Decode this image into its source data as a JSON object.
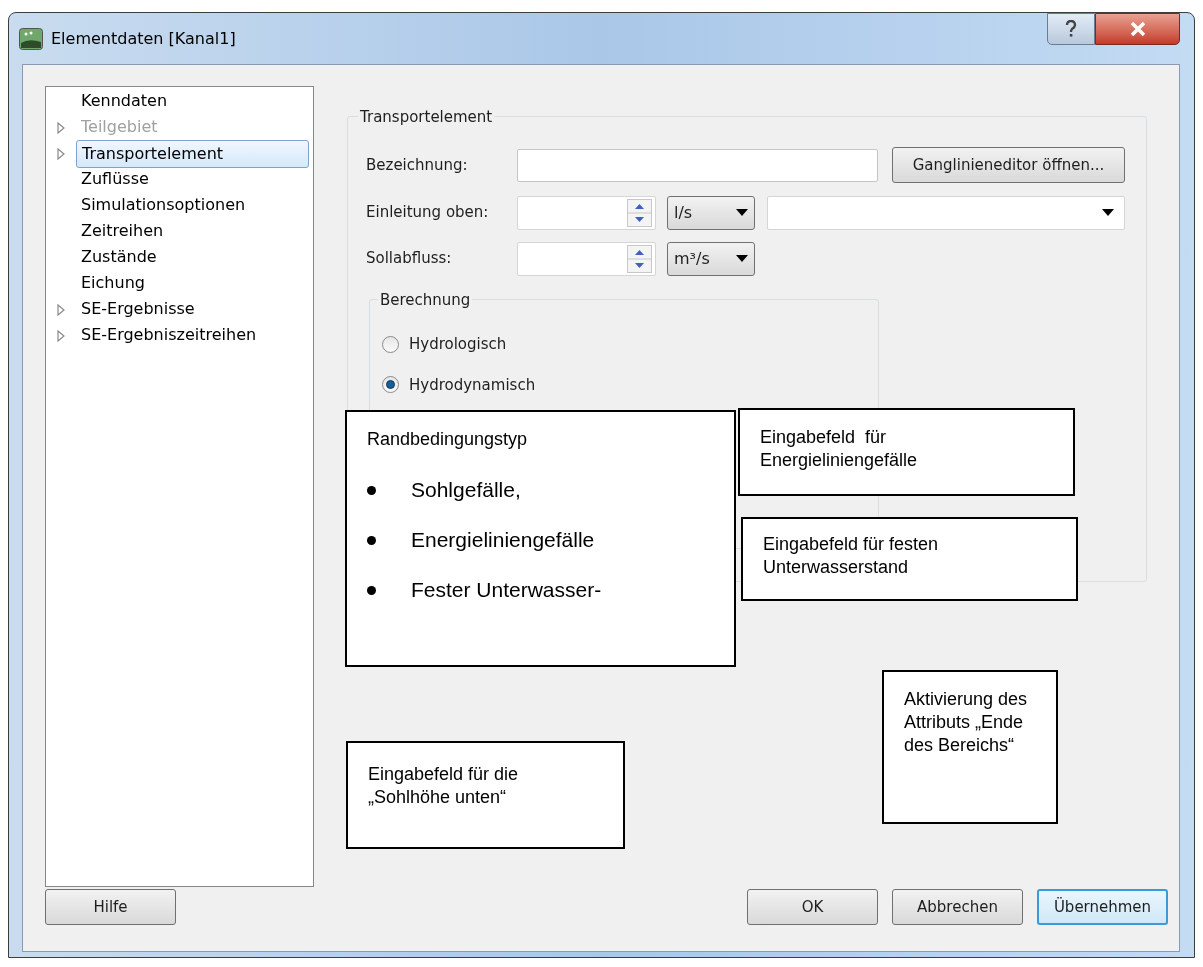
{
  "window": {
    "title": "Elementdaten [Kanal1]"
  },
  "tree": [
    {
      "label": "Kenndaten",
      "expandable": false,
      "disabled": false,
      "selected": false
    },
    {
      "label": "Teilgebiet",
      "expandable": true,
      "disabled": true,
      "selected": false
    },
    {
      "label": "Transportelement",
      "expandable": true,
      "disabled": false,
      "selected": true
    },
    {
      "label": "Zuflüsse",
      "expandable": false,
      "disabled": false,
      "selected": false
    },
    {
      "label": "Simulationsoptionen",
      "expandable": false,
      "disabled": false,
      "selected": false
    },
    {
      "label": "Zeitreihen",
      "expandable": false,
      "disabled": false,
      "selected": false
    },
    {
      "label": "Zustände",
      "expandable": false,
      "disabled": false,
      "selected": false
    },
    {
      "label": "Eichung",
      "expandable": false,
      "disabled": false,
      "selected": false
    },
    {
      "label": "SE-Ergebnisse",
      "expandable": true,
      "disabled": false,
      "selected": false
    },
    {
      "label": "SE-Ergebniszeitreihen",
      "expandable": true,
      "disabled": false,
      "selected": false
    }
  ],
  "group": {
    "title": "Transportelement",
    "bezeichnung": {
      "label": "Bezeichnung:",
      "button": "Ganglinieneditor öffnen..."
    },
    "einleitung": {
      "label": "Einleitung oben:",
      "unit": "l/s"
    },
    "sollabfluss": {
      "label": "Sollabfluss:",
      "unit": "m³/s"
    },
    "berechnung": {
      "title": "Berechnung",
      "options": [
        {
          "label": "Hydrologisch",
          "selected": false
        },
        {
          "label": "Hydrodynamisch",
          "selected": true
        }
      ]
    }
  },
  "callouts": [
    {
      "kind": "list",
      "title": "Randbedingungstyp",
      "items": [
        "Sohlgefälle,",
        "Energieliniengefälle",
        "Fester Unterwasser-"
      ]
    },
    {
      "kind": "text",
      "text": "Eingabefeld  für Energieliniengefälle"
    },
    {
      "kind": "text",
      "text": "Eingabefeld für festen Unterwasserstand"
    },
    {
      "kind": "text",
      "text": "Aktivierung des Attributs „Ende des Bereichs“"
    },
    {
      "kind": "text",
      "text": "Eingabefeld für die „Sohlhöhe unten“"
    }
  ],
  "buttons": {
    "help": "Hilfe",
    "ok": "OK",
    "cancel": "Abbrechen",
    "apply": "Übernehmen"
  }
}
